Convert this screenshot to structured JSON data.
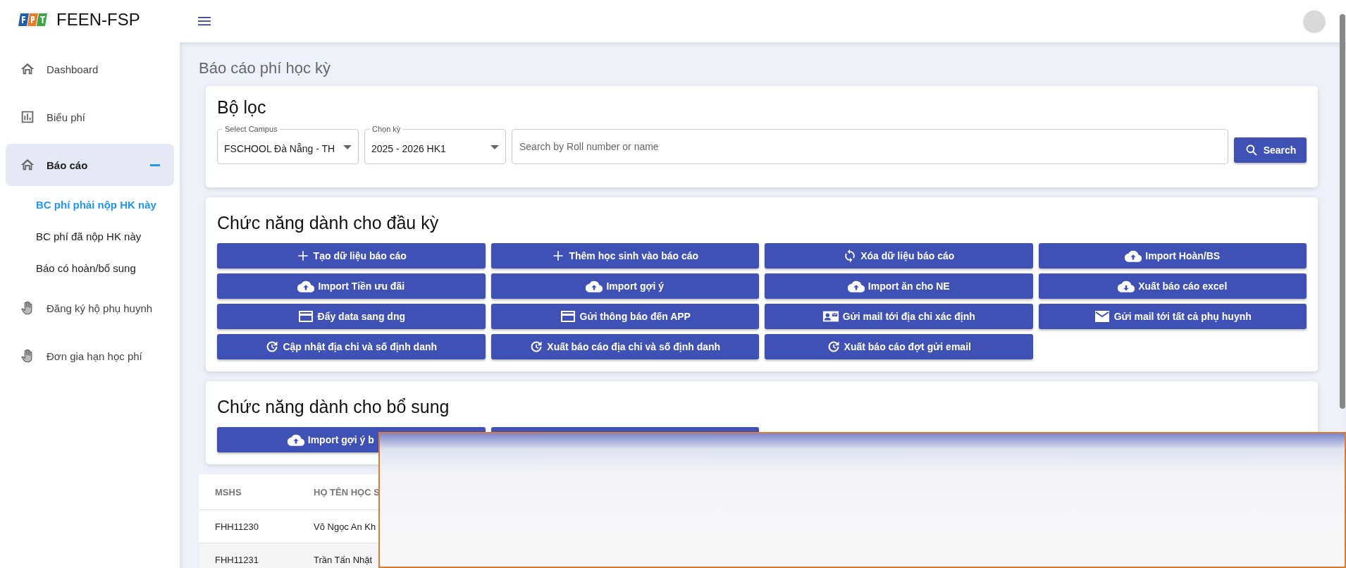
{
  "app": {
    "logo_text": "FEEN-FSP"
  },
  "sidebar": {
    "items": [
      {
        "label": "Dashboard",
        "kind": "home",
        "selected": false,
        "expanded": false
      },
      {
        "label": "Biểu phí",
        "kind": "chart",
        "selected": false,
        "expanded": false
      },
      {
        "label": "Báo cáo",
        "kind": "home",
        "selected": true,
        "expanded": true,
        "children": [
          {
            "label": "BC phí phải nộp HK này",
            "selected": true
          },
          {
            "label": "BC phí đã nộp HK này",
            "selected": false
          },
          {
            "label": "Báo có hoàn/bổ sung",
            "selected": false
          }
        ]
      },
      {
        "label": "Đăng ký hộ phụ huynh",
        "kind": "hand",
        "selected": false,
        "expanded": false
      },
      {
        "label": "Đơn gia hạn học phí",
        "kind": "hand",
        "selected": false,
        "expanded": false
      }
    ]
  },
  "page_title": "Báo cáo phí học kỳ",
  "filter": {
    "title": "Bộ lọc",
    "campus": {
      "label": "Select Campus",
      "value": "FSCHOOL Đà Nẵng - TH"
    },
    "term": {
      "label": "Chọn kỳ",
      "value": "2025 - 2026 HK1"
    },
    "search": {
      "placeholder": "Search by Roll number or name"
    },
    "search_button": "Search"
  },
  "start_functions": {
    "title": "Chức năng dành cho đầu kỳ",
    "buttons": [
      {
        "label": "Tạo dữ liệu báo cáo",
        "kind": "plus"
      },
      {
        "label": "Thêm học sinh vào báo cáo",
        "kind": "plus"
      },
      {
        "label": "Xóa dữ liệu báo cáo",
        "kind": "sync"
      },
      {
        "label": "Import Hoàn/BS",
        "kind": "upload"
      },
      {
        "label": "Import Tiền ưu đãi",
        "kind": "upload"
      },
      {
        "label": "Import gợi ý",
        "kind": "upload"
      },
      {
        "label": "Import ăn cho NE",
        "kind": "upload"
      },
      {
        "label": "Xuất báo cáo excel",
        "kind": "download"
      },
      {
        "label": "Đẩy data sang dng",
        "kind": "card"
      },
      {
        "label": "Gửi thông báo đến APP",
        "kind": "card"
      },
      {
        "label": "Gửi mail tới địa chỉ xác định",
        "kind": "contact"
      },
      {
        "label": "Gửi mail tới tất cả phụ huynh",
        "kind": "mail"
      },
      {
        "label": "Cập nhật địa chỉ và số định danh",
        "kind": "history"
      },
      {
        "label": "Xuất báo cáo địa chỉ và số định danh",
        "kind": "history"
      },
      {
        "label": "Xuất báo cáo đợt gửi email",
        "kind": "history"
      }
    ]
  },
  "bonus_functions": {
    "title": "Chức năng dành cho bổ sung",
    "buttons": [
      {
        "label": "Import gợi ý b",
        "kind": "upload"
      },
      {
        "kind": "blank"
      }
    ]
  },
  "table": {
    "columns": [
      "MSHS",
      "HỌ TÊN HỌC S"
    ],
    "rows": [
      [
        "FHH11230",
        "Võ Ngọc An Kh"
      ],
      [
        "FHH11231",
        "Trần Tấn Nhật"
      ]
    ]
  }
}
